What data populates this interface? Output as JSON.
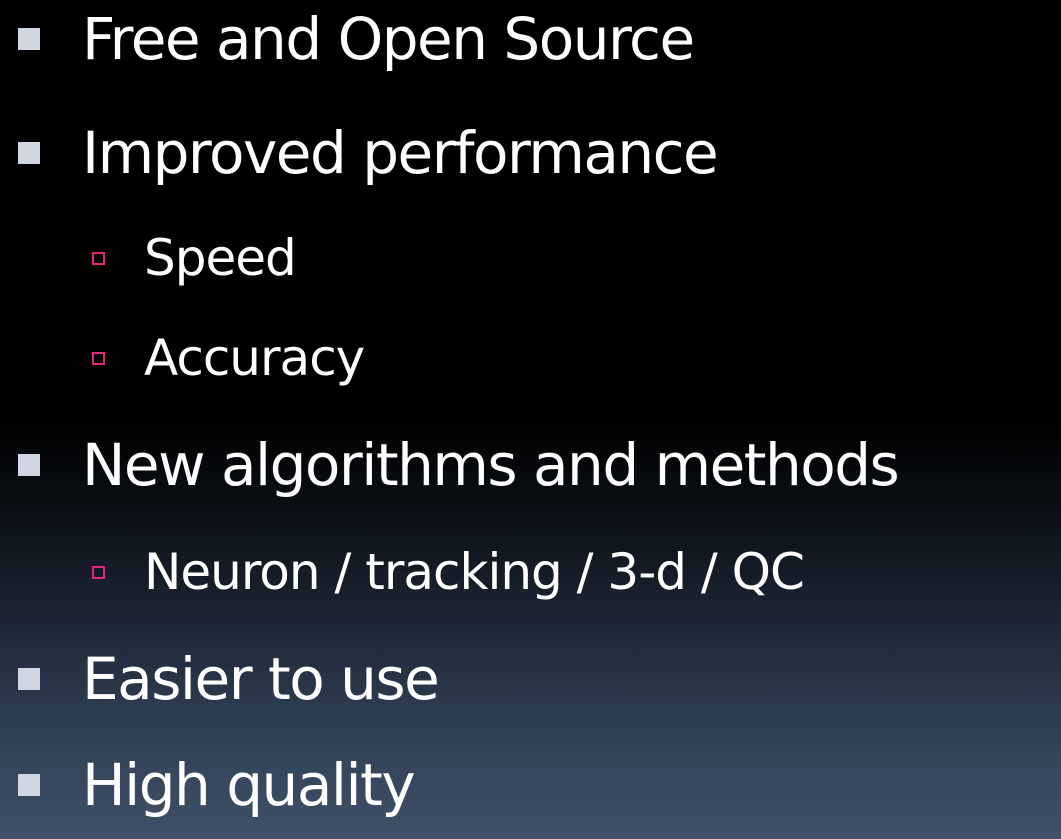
{
  "bullets": [
    {
      "text": "Free and Open Source",
      "level": 1
    },
    {
      "text": "Improved performance",
      "level": 1
    },
    {
      "text": "Speed",
      "level": 2
    },
    {
      "text": "Accuracy",
      "level": 2
    },
    {
      "text": "New algorithms and methods",
      "level": 1
    },
    {
      "text": "Neuron / tracking / 3-d / QC",
      "level": 2
    },
    {
      "text": "Easier to use",
      "level": 1
    },
    {
      "text": "High quality",
      "level": 1
    }
  ],
  "colors": {
    "text": "#ffffff",
    "level1_marker": "#d0d6e2",
    "level2_marker": "#e0277a"
  }
}
